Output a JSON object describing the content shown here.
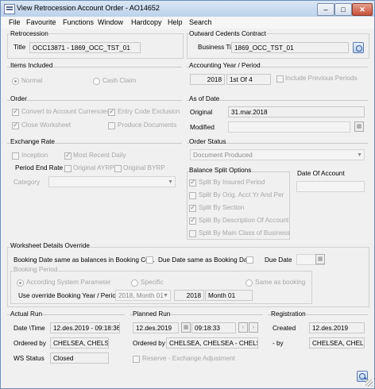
{
  "window": {
    "title": "View Retrocession Account Order - AO14652",
    "min_label": "–",
    "max_label": "□",
    "close_label": "✕"
  },
  "menu": [
    "File",
    "Favourite",
    "Functions",
    "Window",
    "Hardcopy",
    "Help",
    "Search"
  ],
  "retrocession": {
    "header": "Retrocession",
    "title_label": "Title",
    "title_value": "OCC13871 - 1869_OCC_TST_01"
  },
  "outward": {
    "header": "Outward Cedents Contract",
    "business_title_label": "Business Title:",
    "business_title_value": "1869_OCC_TST_01"
  },
  "items_included": {
    "header": "Items Included",
    "normal": "Normal",
    "cash_claim": "Cash Claim"
  },
  "accounting": {
    "header": "Accounting Year / Period",
    "year": "2018",
    "period": "1st Of 4",
    "include_previous": "Include Previous Periods"
  },
  "order": {
    "header": "Order",
    "convert": "Convert to Account Currencies",
    "entry_code": "Entry Code Exclusion",
    "close_worksheet": "Close Worksheet",
    "produce_documents": "Produce Documents"
  },
  "as_of_date": {
    "header": "As of Date",
    "original_label": "Original",
    "original_value": "31.mar.2018",
    "modified_label": "Modified",
    "modified_value": ""
  },
  "exchange_rate": {
    "header": "Exchange Rate",
    "inception": "Inception",
    "most_recent_daily": "Most Recent Daily",
    "period_end_rate": "Period End Rate",
    "original_ayrp": "Original AYRP",
    "original_byrp": "Original BYRP",
    "category_label": "Category",
    "category_value": ""
  },
  "order_status": {
    "header": "Order Status",
    "value": "Document Produced"
  },
  "balance_split": {
    "header": "Balance Split Options",
    "options": [
      {
        "label": "Split By Insured Period",
        "checked": true
      },
      {
        "label": "Split By Orig. Acct Yr And Per",
        "checked": false
      },
      {
        "label": "Split By Section",
        "checked": true
      },
      {
        "label": "Split By Description Of Account",
        "checked": true
      },
      {
        "label": "Split By Main Class of Business",
        "checked": false
      }
    ]
  },
  "date_of_account": {
    "header": "Date Of Account",
    "value": ""
  },
  "worksheet": {
    "header": "Worksheet Details Override",
    "booking_date_same": "Booking Date same as balances in Booking Curr.",
    "due_date_same": "Due Date same as Booking Date",
    "due_date_label": "Due Date",
    "due_date_value": "",
    "booking_period_header": "Booking Period",
    "according_system": "According System Parameter",
    "specific": "Specific",
    "same_as_booking": "Same as booking",
    "use_override": "Use override Booking Year / Period",
    "override_combo": "2018, Month 01",
    "year": "2018",
    "month": "Month 01"
  },
  "actual_run": {
    "header": "Actual Run",
    "date_time_label": "Date \\Time",
    "date_time_value": "12.des.2019 - 09:18:36",
    "ordered_by_label": "Ordered by",
    "ordered_by_value": "CHELSEA, CHELSE",
    "ws_status_label": "WS Status",
    "ws_status_value": "Closed"
  },
  "planned_run": {
    "header": "Planned Run",
    "date_value": "12.des.2019",
    "time_value": "09:18:33",
    "ordered_by_label": "Ordered by",
    "ordered_by_value": "CHELSEA, CHELSEA - CHELSI",
    "reserve": "Reserve - Exchange Adjustment"
  },
  "registration": {
    "header": "Registration",
    "created_label": "Created",
    "created_value": "12.des.2019",
    "by_label": "- by",
    "by_value": "CHELSEA, CHELSE"
  }
}
